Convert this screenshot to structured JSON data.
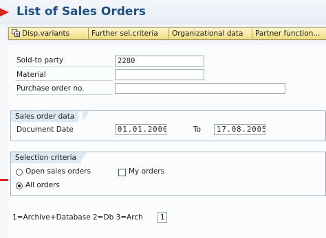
{
  "window": {
    "title": "List of Sales Orders"
  },
  "toolbar": {
    "disp_variants": "Disp.variants",
    "further_sel": "Further sel.criteria",
    "org_data": "Organizational data",
    "partner_function": "Partner function..."
  },
  "selection": {
    "sold_to_label": "Sold-to party",
    "sold_to_value": "2280",
    "material_label": "Material",
    "material_value": "",
    "po_label": "Purchase order no.",
    "po_value": ""
  },
  "sales_order_data": {
    "title": "Sales order data",
    "doc_date_label": "Document Date",
    "date_from": "01.01.2000",
    "to_label": "To",
    "date_to": "17.08.2005"
  },
  "selection_criteria": {
    "title": "Selection criteria",
    "open_orders_label": "Open sales orders",
    "open_orders_selected": false,
    "my_orders_label": "My orders",
    "my_orders_checked": false,
    "all_orders_label": "All orders",
    "all_orders_selected": true
  },
  "archive": {
    "label": "1=Archive+Database 2=Db 3=Arch",
    "value": "1"
  },
  "colors": {
    "title": "#1d4f86",
    "arrow": "#d9261c",
    "button_bg": "#f0dc82",
    "group_tab": "#dde8f2"
  }
}
